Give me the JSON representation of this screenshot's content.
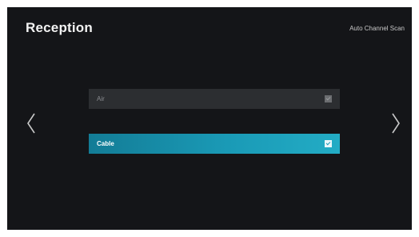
{
  "header": {
    "title": "Reception",
    "context_label": "Auto Channel Scan"
  },
  "options": [
    {
      "label": "Air",
      "selected": false
    },
    {
      "label": "Cable",
      "selected": true
    }
  ],
  "navigation": {
    "left_icon": "chevron-left-icon",
    "right_icon": "chevron-right-icon"
  },
  "colors": {
    "background": "#141518",
    "selected_row": "#1a9ab6"
  }
}
